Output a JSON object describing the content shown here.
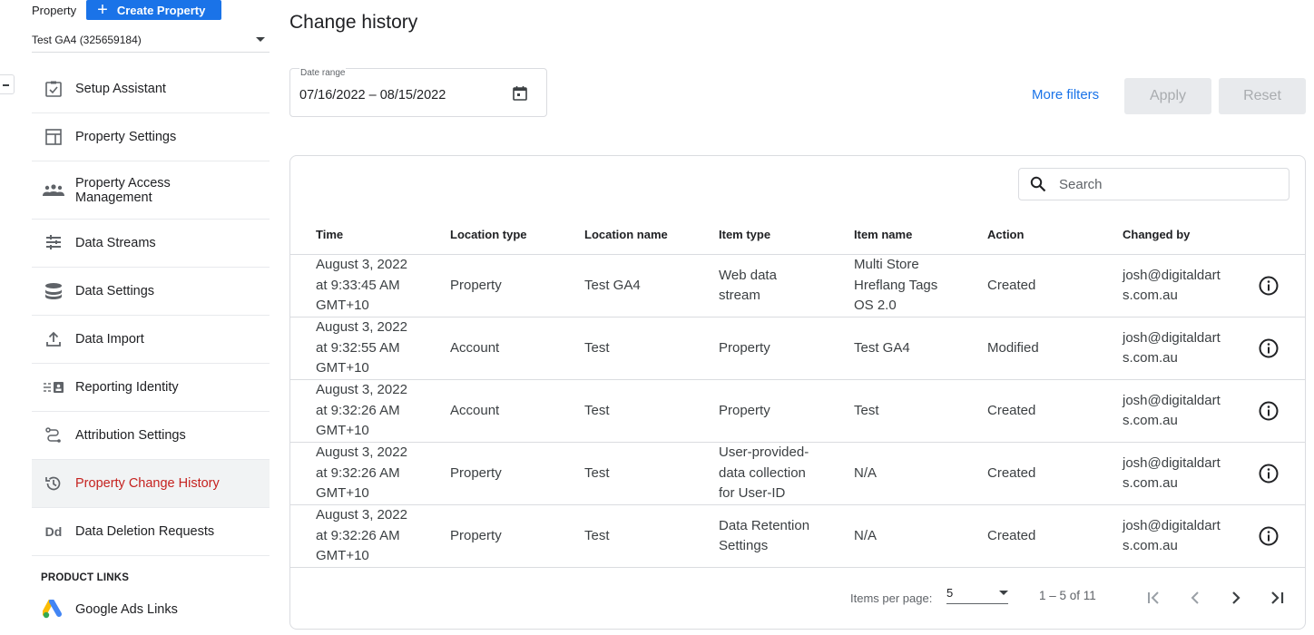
{
  "sidebar": {
    "property_label": "Property",
    "create_label": "Create Property",
    "property_selected": "Test GA4 (325659184)",
    "items": [
      {
        "label": "Setup Assistant",
        "icon": "checklist-icon"
      },
      {
        "label": "Property Settings",
        "icon": "layout-icon"
      },
      {
        "label": "Property Access Management",
        "icon": "people-icon"
      },
      {
        "label": "Data Streams",
        "icon": "streams-icon"
      },
      {
        "label": "Data Settings",
        "icon": "database-icon"
      },
      {
        "label": "Data Import",
        "icon": "upload-icon"
      },
      {
        "label": "Reporting Identity",
        "icon": "identity-icon"
      },
      {
        "label": "Attribution Settings",
        "icon": "attribution-icon"
      },
      {
        "label": "Property Change History",
        "icon": "history-icon",
        "active": true
      },
      {
        "label": "Data Deletion Requests",
        "icon_text": "Dd"
      }
    ],
    "product_links_heading": "PRODUCT LINKS",
    "google_ads_links": "Google Ads Links"
  },
  "main": {
    "title": "Change history",
    "date_range_label": "Date range",
    "date_range_value": "07/16/2022 – 08/15/2022",
    "more_filters": "More filters",
    "apply": "Apply",
    "reset": "Reset",
    "search_placeholder": "Search"
  },
  "table": {
    "columns": [
      "Time",
      "Location type",
      "Location name",
      "Item type",
      "Item name",
      "Action",
      "Changed by"
    ],
    "rows": [
      {
        "time": [
          "August 3, 2022",
          "at 9:33:45 AM",
          "GMT+10"
        ],
        "location_type": "Property",
        "location_name": "Test GA4",
        "item_type": [
          "Web data",
          "stream"
        ],
        "item_name": [
          "Multi Store",
          "Hreflang Tags",
          "OS 2.0"
        ],
        "action": "Created",
        "changed_by": [
          "josh@digitaldart",
          "s.com.au"
        ]
      },
      {
        "time": [
          "August 3, 2022",
          "at 9:32:55 AM",
          "GMT+10"
        ],
        "location_type": "Account",
        "location_name": "Test",
        "item_type": [
          "Property"
        ],
        "item_name": [
          "Test GA4"
        ],
        "action": "Modified",
        "changed_by": [
          "josh@digitaldart",
          "s.com.au"
        ]
      },
      {
        "time": [
          "August 3, 2022",
          "at 9:32:26 AM",
          "GMT+10"
        ],
        "location_type": "Account",
        "location_name": "Test",
        "item_type": [
          "Property"
        ],
        "item_name": [
          "Test"
        ],
        "action": "Created",
        "changed_by": [
          "josh@digitaldart",
          "s.com.au"
        ]
      },
      {
        "time": [
          "August 3, 2022",
          "at 9:32:26 AM",
          "GMT+10"
        ],
        "location_type": "Property",
        "location_name": "Test",
        "item_type": [
          "User-provided-",
          "data collection",
          "for User-ID"
        ],
        "item_name": [
          "N/A"
        ],
        "action": "Created",
        "changed_by": [
          "josh@digitaldart",
          "s.com.au"
        ]
      },
      {
        "time": [
          "August 3, 2022",
          "at 9:32:26 AM",
          "GMT+10"
        ],
        "location_type": "Property",
        "location_name": "Test",
        "item_type": [
          "Data Retention",
          "Settings"
        ],
        "item_name": [
          "N/A"
        ],
        "action": "Created",
        "changed_by": [
          "josh@digitaldart",
          "s.com.au"
        ]
      }
    ]
  },
  "pager": {
    "items_per_page_label": "Items per page:",
    "items_per_page": "5",
    "range": "1 – 5 of 11"
  },
  "colors": {
    "accent": "#1a73e8",
    "active_nav": "#c5221f",
    "disabled_bg": "#e8eaed"
  }
}
